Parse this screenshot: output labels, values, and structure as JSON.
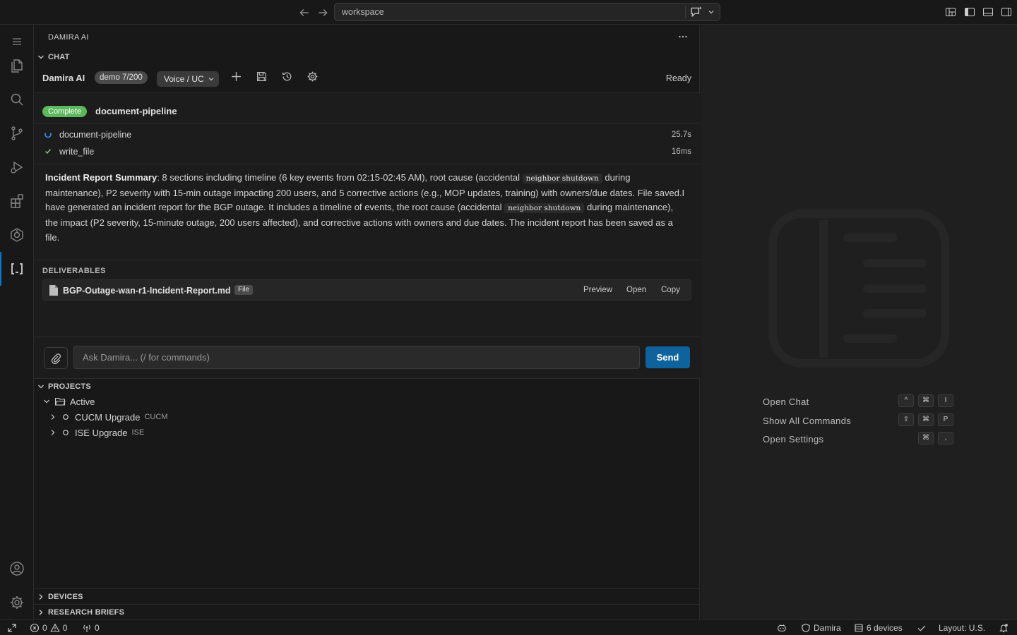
{
  "titlebar": {
    "search_text": "workspace"
  },
  "sidebar": {
    "title": "DAMIRA AI",
    "chat_section": "CHAT",
    "chat_name": "Damira AI",
    "demo_badge": "demo 7/200",
    "voice_select": "Voice / UC",
    "status": "Ready",
    "run": {
      "status_badge": "Complete",
      "title": "document-pipeline",
      "steps": [
        {
          "name": "document-pipeline",
          "time": "25.7s",
          "state": "running"
        },
        {
          "name": "write_file",
          "time": "16ms",
          "state": "done"
        }
      ]
    },
    "summary": {
      "bold": "Incident Report Summary",
      "part1": ": 8 sections including timeline (6 key events from 02:15-02:45 AM), root cause (accidental ",
      "code1": "neighbor shutdown",
      "part2": " during maintenance), P2 severity with 15-min outage impacting 200 users, and 5 corrective actions (e.g., MOP updates, training) with owners/due dates. File saved.I have generated an incident report for the BGP outage. It includes a timeline of events, the root cause (accidental ",
      "code2": "neighbor shutdown",
      "part3": " during maintenance), the impact (P2 severity, 15-minute outage, 200 users affected), and corrective actions with owners and due dates. The incident report has been saved as a file."
    },
    "deliverables": {
      "label": "DELIVERABLES",
      "file_name": "BGP-Outage-wan-r1-Incident-Report.md",
      "file_tag": "File",
      "preview": "Preview",
      "open": "Open",
      "copy": "Copy"
    },
    "input": {
      "placeholder": "Ask Damira... (/ for commands)",
      "send": "Send"
    },
    "projects": {
      "label": "PROJECTS",
      "group": "Active",
      "items": [
        {
          "name": "CUCM Upgrade",
          "tag": "CUCM"
        },
        {
          "name": "ISE Upgrade",
          "tag": "ISE"
        }
      ]
    },
    "devices_label": "DEVICES",
    "research_label": "RESEARCH BRIEFS"
  },
  "editor": {
    "shortcuts": [
      {
        "label": "Open Chat",
        "keys": [
          "^",
          "⌘",
          "I"
        ]
      },
      {
        "label": "Show All Commands",
        "keys": [
          "⇧",
          "⌘",
          "P"
        ]
      },
      {
        "label": "Open Settings",
        "keys": [
          "⌘",
          ","
        ]
      }
    ]
  },
  "statusbar": {
    "errors": "0",
    "warnings": "0",
    "ports": "0",
    "account": "Damira",
    "devices": "6 devices",
    "layout": "Layout: U.S."
  },
  "colors": {
    "accent": "#0078d4",
    "send": "#0e639c",
    "complete": "#5cb85c",
    "running": "#3794ff",
    "done": "#89d185"
  }
}
